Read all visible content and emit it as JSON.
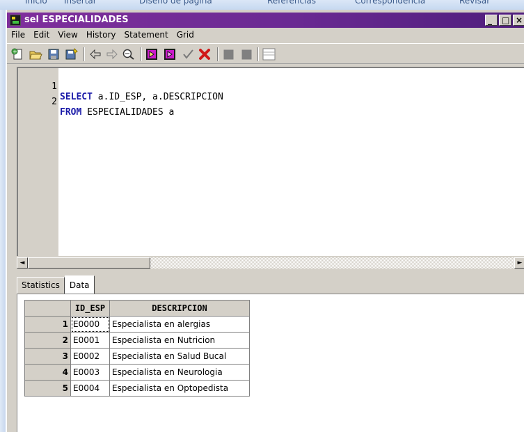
{
  "background_ribbon": [
    "Inicio",
    "Insertar",
    "Diseño de página",
    "Referencias",
    "Correspondencia",
    "Revisar"
  ],
  "window": {
    "title": "sel ESPECIALIDADES",
    "minimize_glyph": "_",
    "maximize_glyph": "□",
    "close_glyph": "×"
  },
  "menu": [
    "File",
    "Edit",
    "View",
    "History",
    "Statement",
    "Grid"
  ],
  "toolbar": {
    "icons": [
      "new-sql-icon",
      "open-folder-icon",
      "save-icon",
      "save-as-icon",
      "back-arrow-icon",
      "forward-arrow-icon",
      "find-icon",
      "execute-icon",
      "execute-step-icon",
      "commit-check-icon",
      "rollback-x-icon",
      "disabled-square-icon",
      "disabled-square-icon",
      "single-record-view-icon"
    ],
    "colors": {
      "execute": "#cc1ccc",
      "rollback": "#d01818",
      "check": "#7a7a7a"
    }
  },
  "editor": {
    "lines": [
      {
        "number": "1",
        "keyword": "SELECT",
        "rest": " a.ID_ESP, a.DESCRIPCION"
      },
      {
        "number": "2",
        "keyword": "FROM",
        "rest": " ESPECIALIDADES a"
      }
    ],
    "keyword_color": "#1a1aa8"
  },
  "tabs": {
    "statistics": "Statistics",
    "data": "Data",
    "active": "Data"
  },
  "grid": {
    "columns": [
      "ID_ESP",
      "DESCRIPCION"
    ],
    "rows": [
      {
        "n": "1",
        "id": "E0000",
        "desc": "Especialista en alergias"
      },
      {
        "n": "2",
        "id": "E0001",
        "desc": "Especialista en Nutricion"
      },
      {
        "n": "3",
        "id": "E0002",
        "desc": "Especialista en Salud Bucal"
      },
      {
        "n": "4",
        "id": "E0003",
        "desc": "Especialista en Neurologia"
      },
      {
        "n": "5",
        "id": "E0004",
        "desc": "Especialista en Optopedista"
      }
    ]
  }
}
